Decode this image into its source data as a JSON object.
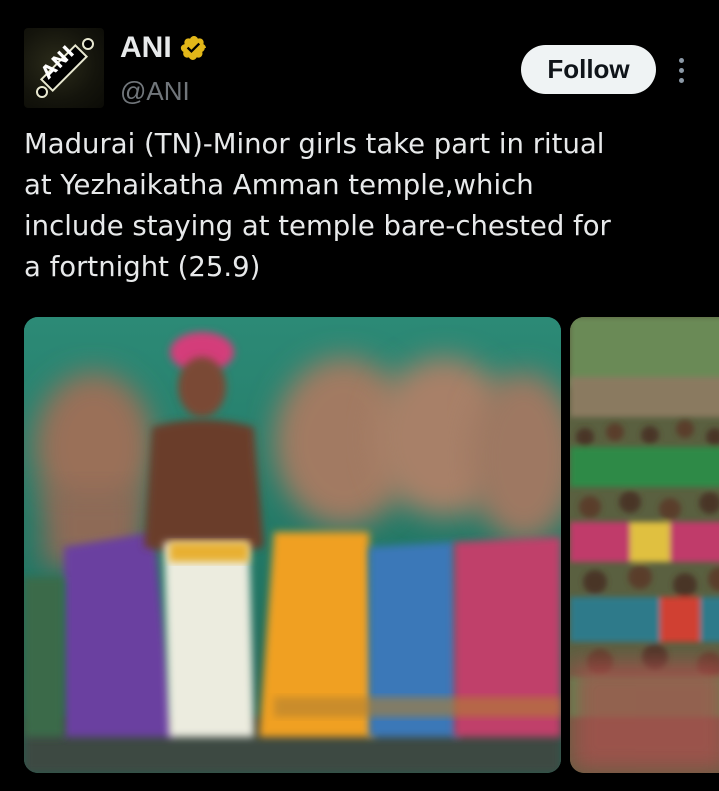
{
  "author": {
    "avatar_text": "ANI",
    "display_name": "ANI",
    "handle": "@ANI",
    "verified_color": "#e2b719"
  },
  "actions": {
    "follow_label": "Follow",
    "more_icon": "more-vertical-icon"
  },
  "tweet": {
    "text": "Madurai (TN)-Minor girls take part in ritual\nat Yezhaikatha Amman temple,which\ninclude staying at temple bare-chested for\na fortnight (25.9)"
  },
  "media": {
    "count_visible": 2
  },
  "colors": {
    "background": "#000000",
    "text": "#e7e9ea",
    "secondary_text": "#71767b",
    "follow_bg": "#eff3f4"
  }
}
